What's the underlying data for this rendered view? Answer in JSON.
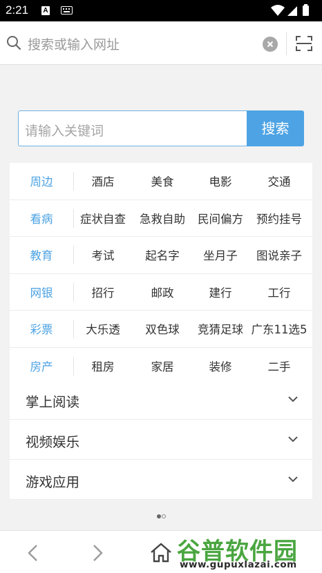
{
  "status_bar": {
    "time": "2:21",
    "notification_badge": "A"
  },
  "address_bar": {
    "placeholder": "搜索或输入网址"
  },
  "search": {
    "placeholder": "请输入关键词",
    "button_label": "搜索"
  },
  "categories": [
    {
      "name": "周边",
      "items": [
        "酒店",
        "美食",
        "电影",
        "交通"
      ]
    },
    {
      "name": "看病",
      "items": [
        "症状自查",
        "急救自助",
        "民间偏方",
        "预约挂号"
      ]
    },
    {
      "name": "教育",
      "items": [
        "考试",
        "起名字",
        "坐月子",
        "图说亲子"
      ]
    },
    {
      "name": "网银",
      "items": [
        "招行",
        "邮政",
        "建行",
        "工行"
      ]
    },
    {
      "name": "彩票",
      "items": [
        "大乐透",
        "双色球",
        "竞猜足球",
        "广东11选5"
      ]
    },
    {
      "name": "房产",
      "items": [
        "租房",
        "家居",
        "装修",
        "二手"
      ]
    }
  ],
  "sections": [
    {
      "label": "掌上阅读"
    },
    {
      "label": "视频娱乐"
    },
    {
      "label": "游戏应用"
    }
  ],
  "watermark": {
    "title": "谷普软件园",
    "url": "www.gupuxlazai.com"
  },
  "colors": {
    "accent": "#4da3e3",
    "watermark_green": "#4aa640"
  }
}
